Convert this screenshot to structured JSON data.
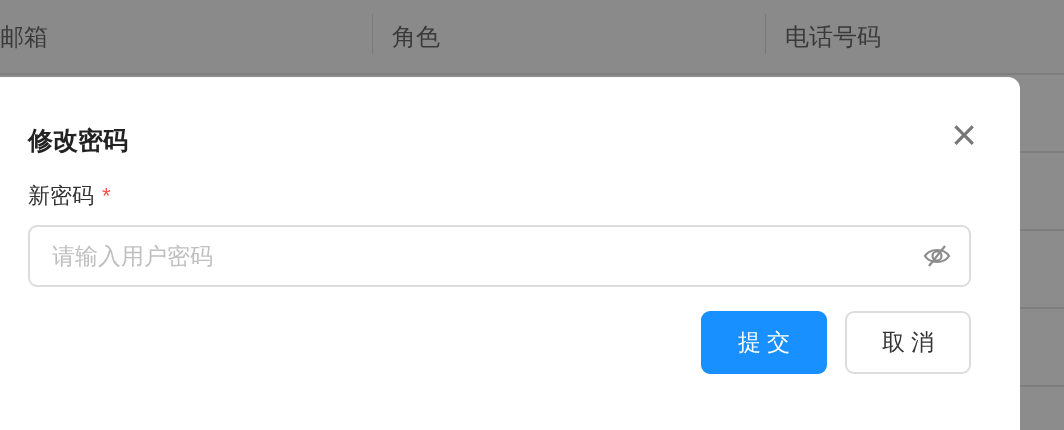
{
  "table": {
    "columns": [
      "邮箱",
      "角色",
      "电话号码"
    ]
  },
  "dialog": {
    "title": "修改密码",
    "close": "×",
    "field": {
      "label": "新密码",
      "required_mark": "*",
      "placeholder": "请输入用户密码"
    },
    "buttons": [
      {
        "label": "提 交",
        "kind": "primary"
      },
      {
        "label": "取 消",
        "kind": "default"
      }
    ]
  }
}
